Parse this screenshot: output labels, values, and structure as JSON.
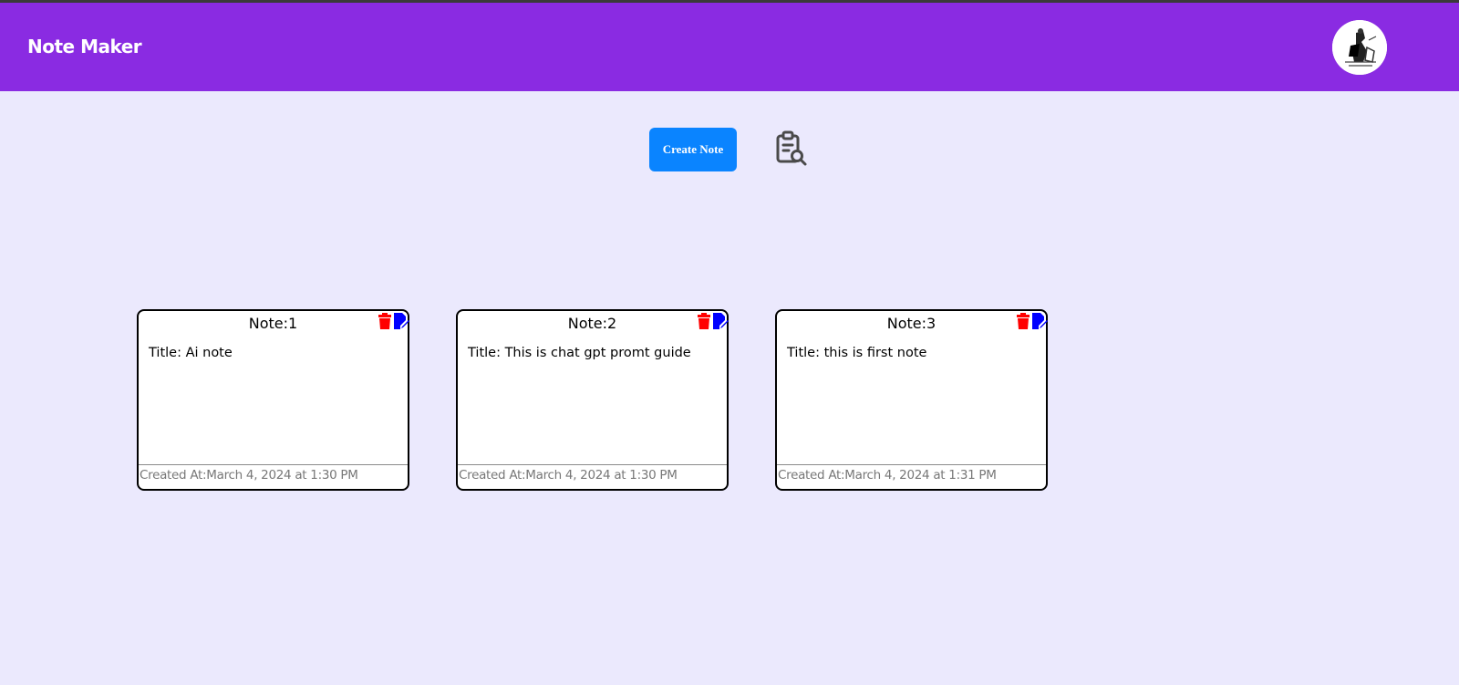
{
  "app": {
    "title": "Note Maker"
  },
  "toolbar": {
    "create_label": "Create Note",
    "search_icon": "clipboard-search-icon"
  },
  "colors": {
    "navbar": "#8a2be2",
    "background": "#ebe9fd",
    "button": "#0a84ff",
    "delete": "#ff0000",
    "edit": "#0000ff"
  },
  "notes": [
    {
      "heading": "Note:1",
      "title": "Title: Ai note",
      "created": "Created At:March 4, 2024 at 1:30 PM"
    },
    {
      "heading": "Note:2",
      "title": "Title: This is chat gpt promt guide",
      "created": "Created At:March 4, 2024 at 1:30 PM"
    },
    {
      "heading": "Note:3",
      "title": "Title: this is first note",
      "created": "Created At:March 4, 2024 at 1:31 PM"
    }
  ]
}
